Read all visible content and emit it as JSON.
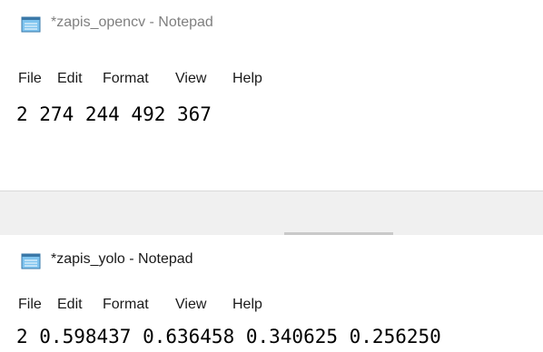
{
  "windows": [
    {
      "title": "*zapis_opencv - Notepad",
      "menu": [
        "File",
        "Edit",
        "Format",
        "View",
        "Help"
      ],
      "content": "2 274 244 492 367"
    },
    {
      "title": "*zapis_yolo - Notepad",
      "menu": [
        "File",
        "Edit",
        "Format",
        "View",
        "Help"
      ],
      "content": "2 0.598437 0.636458 0.340625 0.256250"
    }
  ],
  "icons": {
    "app_icon": "notepad-icon"
  }
}
